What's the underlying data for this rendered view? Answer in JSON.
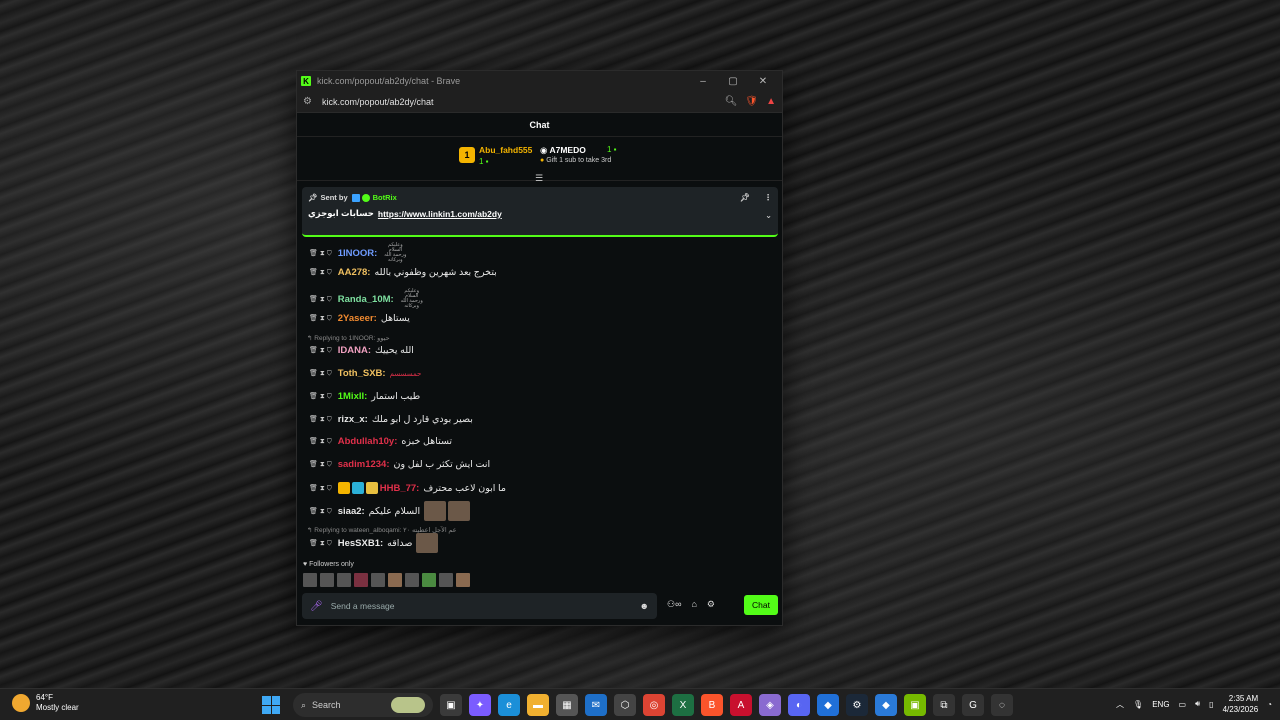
{
  "window": {
    "title": "kick.com/popout/ab2dy/chat - Brave",
    "url": "kick.com/popout/ab2dy/chat"
  },
  "chat": {
    "header": "Chat",
    "leaderboard": {
      "first_name": "Abu_fahd555",
      "first_count": "1",
      "second_name": "A7MEDO",
      "second_count": "1",
      "gift_text": "Gift 1 sub to take 3rd"
    },
    "pinned": {
      "sent_by": "Sent by",
      "bot_name": "BotRix",
      "message": "حسابات ابوجزي",
      "link": "https://www.linkin1.com/ab2dy"
    },
    "messages": [
      {
        "user": "1INOOR:",
        "color": "#6f9cff",
        "text": "وعليكم السلام ورحمة الله وبركاته"
      },
      {
        "user": "AA278:",
        "color": "#f0c060",
        "text": "بتخرج بعد شهرين وظفوني بالله"
      },
      {
        "user": "Randa_10M:",
        "color": "#7ee0a0",
        "text": "وعليكم السلام ورحمة الله وبركاته"
      },
      {
        "user": "2Yaseer:",
        "color": "#f08a30",
        "text": "يستاهل"
      },
      {
        "user": "IDANA:",
        "color": "#f0a0c0",
        "text": "الله يحييك",
        "reply": "Replying to 1INOOR: حيوو"
      },
      {
        "user": "Toth_SXB:",
        "color": "#f0c060",
        "text": "حمسسسم"
      },
      {
        "user": "1MixII:",
        "color": "#53fc18",
        "text": "طيب استمار"
      },
      {
        "user": "rizx_x:",
        "color": "#e8e8e8",
        "text": "بصير بودي قارد ل ابو ملك"
      },
      {
        "user": "Abdullah10y:",
        "color": "#e0304a",
        "text": "تستاهل خبزه"
      },
      {
        "user": "sadim1234:",
        "color": "#e0304a",
        "text": "انت ايش تكثر ب لفل ون"
      },
      {
        "user": "HHB_77:",
        "color": "#e0304a",
        "text": "ما ابون لاعب محترف"
      },
      {
        "user": "siaa2:",
        "color": "#e8e8e8",
        "text": "السلام عليكم"
      },
      {
        "user": "HesSXB1:",
        "color": "#e8e8e8",
        "text": "صداقه",
        "reply": "Replying to wateen_alboqami: عم الآجل اعطيته ٢٠"
      }
    ],
    "followers_only": "Followers only",
    "input_placeholder": "Send a message",
    "send_label": "Chat"
  },
  "taskbar": {
    "temperature": "64°F",
    "weather": "Mostly clear",
    "search": "Search",
    "language": "ENG",
    "time": "2:35 AM",
    "date": "4/23/2026"
  }
}
